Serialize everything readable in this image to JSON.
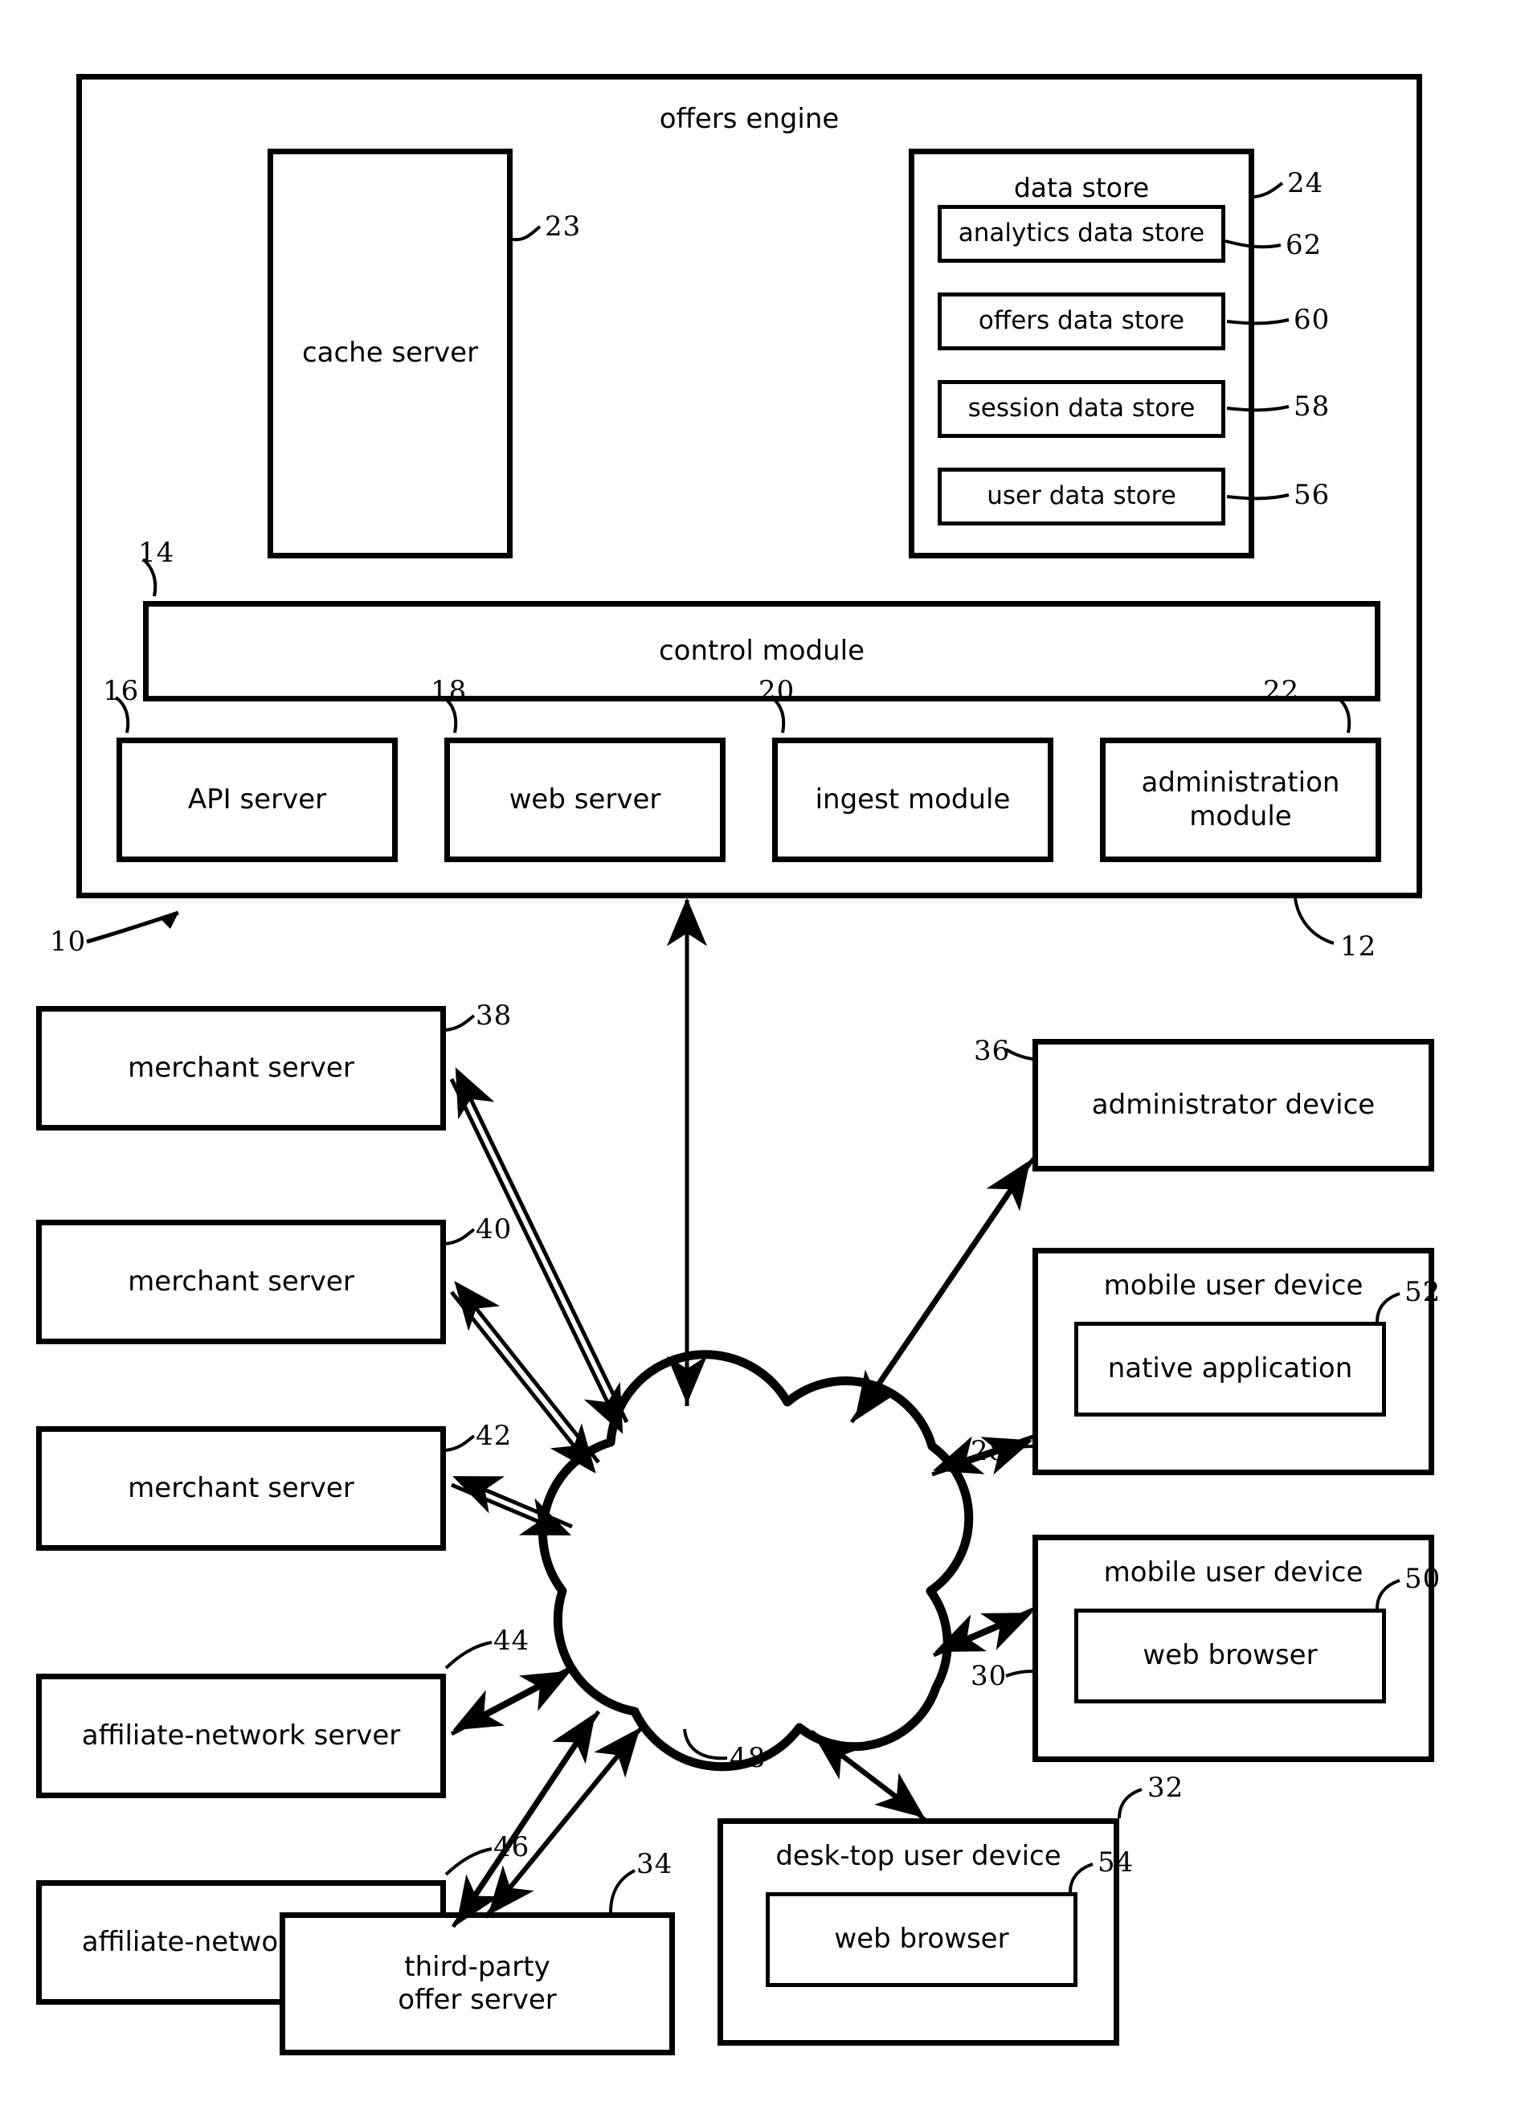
{
  "figure": {
    "type": "patent-system-architecture-diagram",
    "system_ref": "10",
    "colors": {
      "ink": "#000000",
      "paper": "#ffffff"
    }
  },
  "offers_engine": {
    "title": "offers engine",
    "ref": "12",
    "cache_server": {
      "label": "cache server",
      "ref": "23"
    },
    "data_store": {
      "label": "data store",
      "ref": "24",
      "items": [
        {
          "label": "analytics data store",
          "ref": "62"
        },
        {
          "label": "offers data store",
          "ref": "60"
        },
        {
          "label": "session data store",
          "ref": "58"
        },
        {
          "label": "user data store",
          "ref": "56"
        }
      ]
    },
    "control_module": {
      "label": "control module",
      "ref": "14"
    },
    "modules": [
      {
        "label": "API server",
        "ref": "16"
      },
      {
        "label": "web server",
        "ref": "18"
      },
      {
        "label": "ingest module",
        "ref": "20"
      },
      {
        "label": "administration\nmodule",
        "ref": "22"
      }
    ]
  },
  "network": {
    "label": "",
    "ref": "48",
    "shape": "cloud"
  },
  "left_nodes": [
    {
      "label": "merchant server",
      "ref": "38"
    },
    {
      "label": "merchant server",
      "ref": "40"
    },
    {
      "label": "merchant server",
      "ref": "42"
    },
    {
      "label": "affiliate-network server",
      "ref": "44"
    },
    {
      "label": "affiliate-network server",
      "ref": "46"
    }
  ],
  "bottom_nodes": [
    {
      "label": "third-party\noffer server",
      "ref": "34"
    }
  ],
  "right_nodes": [
    {
      "label": "administrator device",
      "ref": "36",
      "child": null
    },
    {
      "label": "mobile user device",
      "ref": "28",
      "child": {
        "label": "native application",
        "ref": "52"
      }
    },
    {
      "label": "mobile user device",
      "ref": "30",
      "child": {
        "label": "web browser",
        "ref": "50"
      }
    }
  ],
  "desktop_node": {
    "label": "desk-top user device",
    "ref": "32",
    "child": {
      "label": "web browser",
      "ref": "54"
    }
  },
  "system_ref_label": {
    "ref": "10"
  }
}
